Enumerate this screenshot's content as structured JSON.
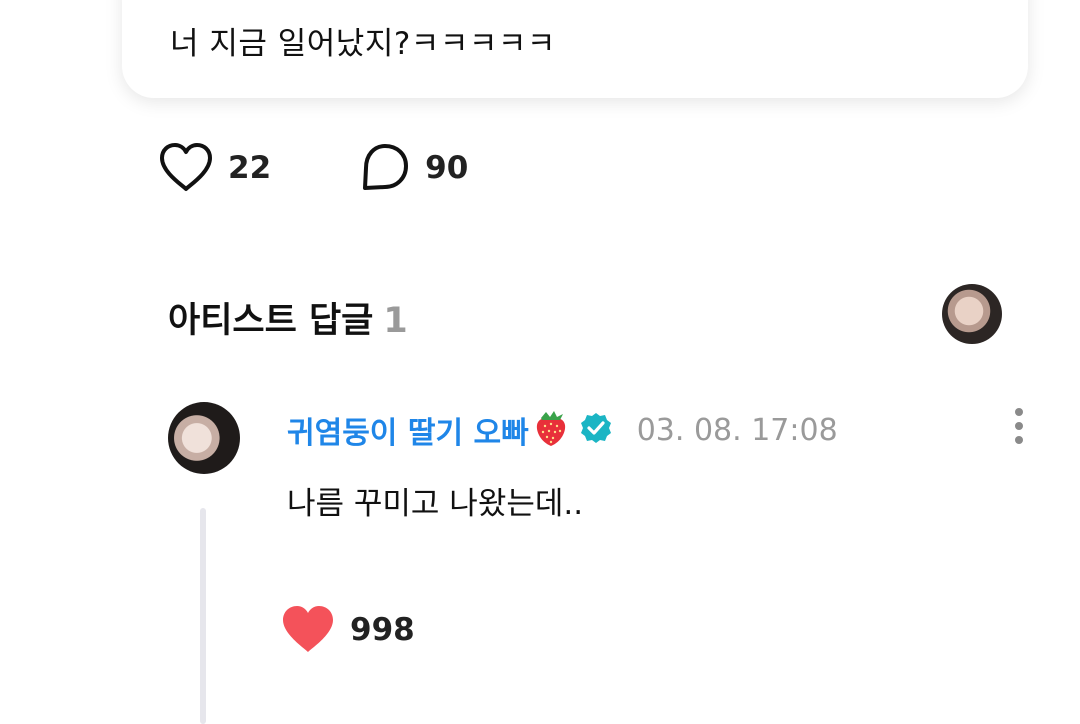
{
  "post": {
    "text": "너 지금 일어났지?ㅋㅋㅋㅋㅋ",
    "avatar_icon": "user-avatar"
  },
  "actions": {
    "likes": "22",
    "comments": "90",
    "like_icon": "heart-outline-icon",
    "comment_icon": "speech-bubble-icon"
  },
  "artist_replies": {
    "title": "아티스트 답글",
    "count": "1"
  },
  "reply": {
    "author": "귀염둥이 딸기 오빠",
    "author_emoji": "🍓",
    "verified_icon": "verified-badge-icon",
    "date": "03. 08. 17:08",
    "text": "나름 꾸미고 나왔는데..",
    "likes": "998"
  },
  "colors": {
    "author": "#1f86e8",
    "verified": "#1bb5c4",
    "liked_heart": "#f4525a",
    "muted": "#9a9a9a"
  }
}
